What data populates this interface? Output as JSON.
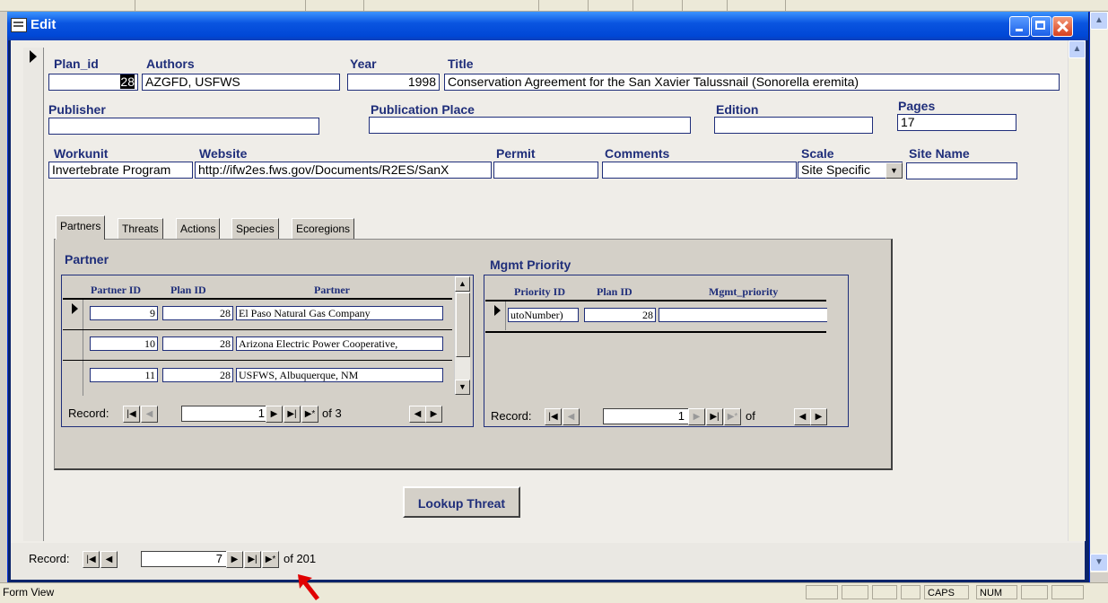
{
  "window": {
    "title": "Edit"
  },
  "fields": {
    "plan_id": {
      "label": "Plan_id",
      "value": "28"
    },
    "authors": {
      "label": "Authors",
      "value": "AZGFD, USFWS"
    },
    "year": {
      "label": "Year",
      "value": "1998"
    },
    "title": {
      "label": "Title",
      "value": "Conservation Agreement for the San Xavier Talussnail (Sonorella eremita)"
    },
    "publisher": {
      "label": "Publisher",
      "value": ""
    },
    "publication_place": {
      "label": "Publication Place",
      "value": ""
    },
    "edition": {
      "label": "Edition",
      "value": ""
    },
    "pages": {
      "label": "Pages",
      "value": "17"
    },
    "workunit": {
      "label": "Workunit",
      "value": "Invertebrate Program"
    },
    "website": {
      "label": "Website",
      "value": "http://ifw2es.fws.gov/Documents/R2ES/SanX"
    },
    "permit": {
      "label": "Permit",
      "value": ""
    },
    "comments": {
      "label": "Comments",
      "value": ""
    },
    "scale": {
      "label": "Scale",
      "value": "Site Specific"
    },
    "site_name": {
      "label": "Site Name",
      "value": ""
    }
  },
  "tabs": [
    "Partners",
    "Threats",
    "Actions",
    "Species",
    "Ecoregions"
  ],
  "partner_subform": {
    "title": "Partner",
    "columns": [
      "Partner ID",
      "Plan ID",
      "Partner"
    ],
    "rows": [
      {
        "partner_id": "9",
        "plan_id": "28",
        "partner": "El Paso Natural Gas Company"
      },
      {
        "partner_id": "10",
        "plan_id": "28",
        "partner": "Arizona Electric Power Cooperative,"
      },
      {
        "partner_id": "11",
        "plan_id": "28",
        "partner": "USFWS, Albuquerque, NM"
      }
    ],
    "nav": {
      "label": "Record:",
      "current": "1",
      "of": "of 3"
    }
  },
  "mgmt_subform": {
    "title": "Mgmt Priority",
    "columns": [
      "Priority ID",
      "Plan ID",
      "Mgmt_priority"
    ],
    "rows": [
      {
        "priority_id": "utoNumber)",
        "plan_id": "28",
        "mgmt_priority": ""
      }
    ],
    "nav": {
      "label": "Record:",
      "current": "1",
      "of": "of"
    }
  },
  "lookup_button": "Lookup Threat",
  "main_nav": {
    "label": "Record:",
    "current": "7",
    "of": "of 201"
  },
  "status": {
    "view": "Form View",
    "caps": "CAPS",
    "num": "NUM"
  }
}
